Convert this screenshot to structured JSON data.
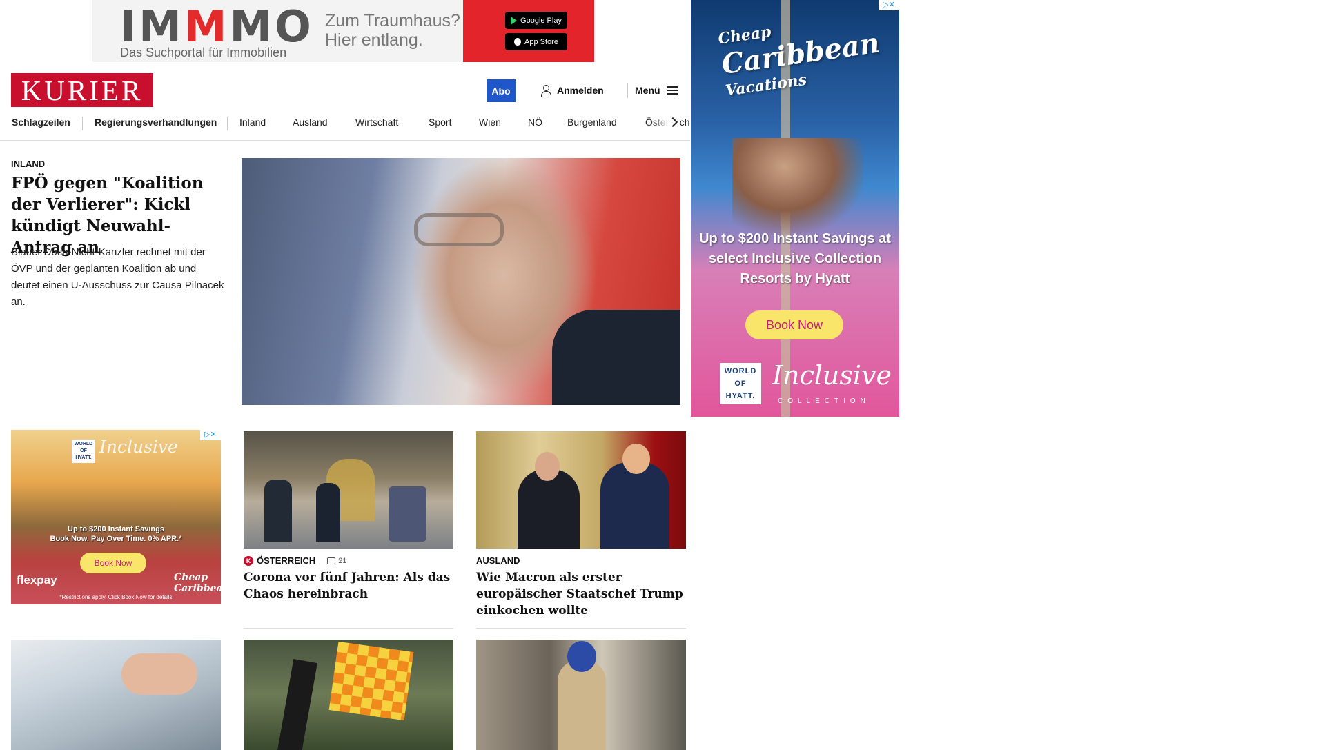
{
  "top_ad": {
    "brand_part1": "IM",
    "brand_highlight": "M",
    "brand_part2": "MO",
    "tagline": "Das Suchportal für Immobilien",
    "slogan_line1": "Zum Traumhaus?",
    "slogan_line2": "Hier entlang.",
    "google_play": "Google Play",
    "app_store": "App Store"
  },
  "header": {
    "logo": "KURIER",
    "abo": "Abo",
    "login": "Anmelden",
    "menu": "Menü"
  },
  "nav": {
    "items": [
      "Schlagzeilen",
      "Regierungsverhandlungen",
      "Inland",
      "Ausland",
      "Wirtschaft",
      "Sport",
      "Wien",
      "NÖ",
      "Burgenland",
      "Österreich"
    ]
  },
  "lead": {
    "kicker": "INLAND",
    "title": "FPÖ gegen \"Koalition der Verlierer\": Kickl kündigt Neuwahl-Antrag an",
    "teaser": "Blauer Doch-Nicht-Kanzler rechnet mit der ÖVP und der geplanten Koalition ab und deutet einen U-Ausschuss zur Causa Pilnacek an."
  },
  "side_ad": {
    "headline_small": "Cheap",
    "headline_big": "Caribbean",
    "headline_sub": "Vacations",
    "offer": "Up to $200 Instant Savings at select Inclusive Collection Resorts by Hyatt",
    "cta": "Book Now",
    "hyatt_logo": "WORLD OF HYATT.",
    "inclusive": "Inclusive",
    "collection": "COLLECTION"
  },
  "small_ad": {
    "hyatt_logo": "WORLD OF HYATT.",
    "inclusive": "Inclusive",
    "offer_line1": "Up to $200 Instant Savings",
    "offer_line2": "Book Now. Pay Over Time. 0% APR.*",
    "cta": "Book Now",
    "flexpay": "flexpay",
    "cheap_caribbean": "Cheap Caribbean",
    "fine_print": "*Restrictions apply. Click Book Now for details"
  },
  "cards": [
    {
      "kicker": "ÖSTERREICH",
      "comments": "21",
      "title": "Corona vor fünf Jahren: Als das Chaos hereinbrach"
    },
    {
      "kicker": "AUSLAND",
      "title": "Wie Macron als erster europäischer Staatschef Trump einkochen wollte"
    }
  ],
  "colors": {
    "brand_red": "#c8102e",
    "abo_blue": "#1f56c9",
    "ad_yellow": "#f8e56a"
  }
}
